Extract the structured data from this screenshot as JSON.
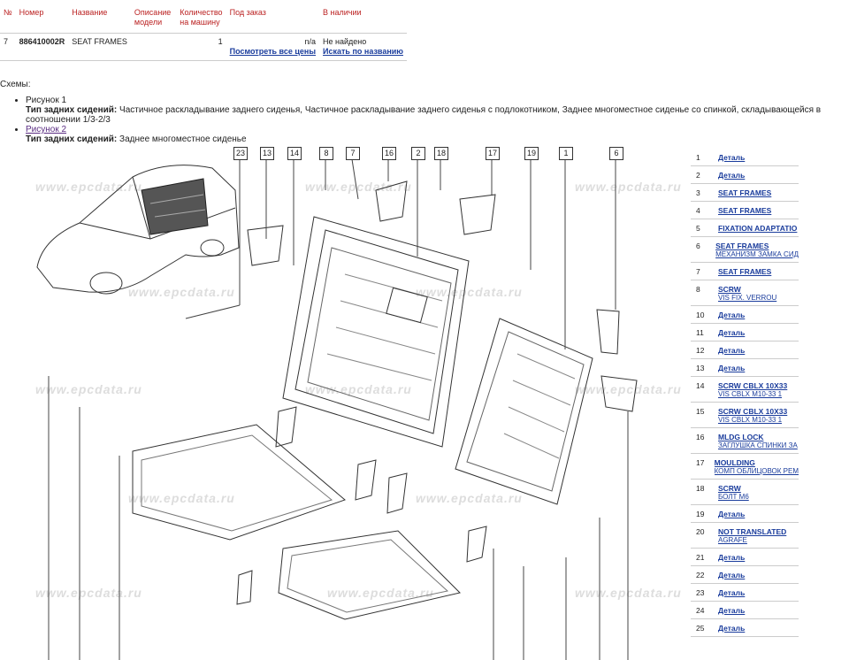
{
  "table": {
    "headers": [
      "№",
      "Номер",
      "Название",
      "Описание модели",
      "Количество на машину",
      "Под заказ",
      "В наличии"
    ],
    "row": {
      "num": "7",
      "part_number": "886410002R",
      "name": "SEAT FRAMES",
      "model_desc": "",
      "qty": "1",
      "order": "n/a",
      "stock": "Не найдено",
      "link_prices": "Посмотреть все цены",
      "link_search": "Искать по названию"
    }
  },
  "schemes": {
    "title": "Схемы:",
    "items": [
      {
        "label": "Рисунок 1",
        "desc_key": "Тип задних сидений:",
        "desc_val": "Частичное раскладывание заднего сиденья, Частичное раскладывание заднего сиденья с подлокотником, Заднее многоместное сиденье со спинкой, складывающейся в соотношении 1/3-2/3"
      },
      {
        "label": "Рисунок 2",
        "desc_key": "Тип задних сидений:",
        "desc_val": "Заднее многоместное сиденье"
      }
    ]
  },
  "watermark": "www.epcdata.ru",
  "callouts": [
    "23",
    "13",
    "14",
    "8",
    "7",
    "16",
    "2",
    "18",
    "17",
    "19",
    "1",
    "6"
  ],
  "legend": [
    {
      "num": "1",
      "label": "Деталь",
      "sub": ""
    },
    {
      "num": "2",
      "label": "Деталь",
      "sub": ""
    },
    {
      "num": "3",
      "label": "SEAT FRAMES",
      "sub": ""
    },
    {
      "num": "4",
      "label": "SEAT FRAMES",
      "sub": ""
    },
    {
      "num": "5",
      "label": "FIXATION ADAPTATIO",
      "sub": ""
    },
    {
      "num": "6",
      "label": "SEAT FRAMES",
      "sub": "МЕХАНИЗМ ЗАМКА СИД"
    },
    {
      "num": "7",
      "label": "SEAT FRAMES",
      "sub": ""
    },
    {
      "num": "8",
      "label": "SCRW",
      "sub": "VIS FIX. VERROU"
    },
    {
      "num": "10",
      "label": "Деталь",
      "sub": ""
    },
    {
      "num": "11",
      "label": "Деталь",
      "sub": ""
    },
    {
      "num": "12",
      "label": "Деталь",
      "sub": ""
    },
    {
      "num": "13",
      "label": "Деталь",
      "sub": ""
    },
    {
      "num": "14",
      "label": "SCRW CBLX 10X33",
      "sub": "VIS CBLX M10-33 1"
    },
    {
      "num": "15",
      "label": "SCRW CBLX 10X33",
      "sub": "VIS CBLX M10-33 1"
    },
    {
      "num": "16",
      "label": "MLDG LOCK",
      "sub": "ЗАГЛУШКА СПИНКИ ЗА"
    },
    {
      "num": "17",
      "label": "MOULDING",
      "sub": "КОМП ОБЛИЦОВОК РЕМ"
    },
    {
      "num": "18",
      "label": "SCRW",
      "sub": "БОЛТ M6"
    },
    {
      "num": "19",
      "label": "Деталь",
      "sub": ""
    },
    {
      "num": "20",
      "label": "NOT TRANSLATED",
      "sub": "AGRAFE"
    },
    {
      "num": "21",
      "label": "Деталь",
      "sub": ""
    },
    {
      "num": "22",
      "label": "Деталь",
      "sub": ""
    },
    {
      "num": "23",
      "label": "Деталь",
      "sub": ""
    },
    {
      "num": "24",
      "label": "Деталь",
      "sub": ""
    },
    {
      "num": "25",
      "label": "Деталь",
      "sub": ""
    }
  ]
}
